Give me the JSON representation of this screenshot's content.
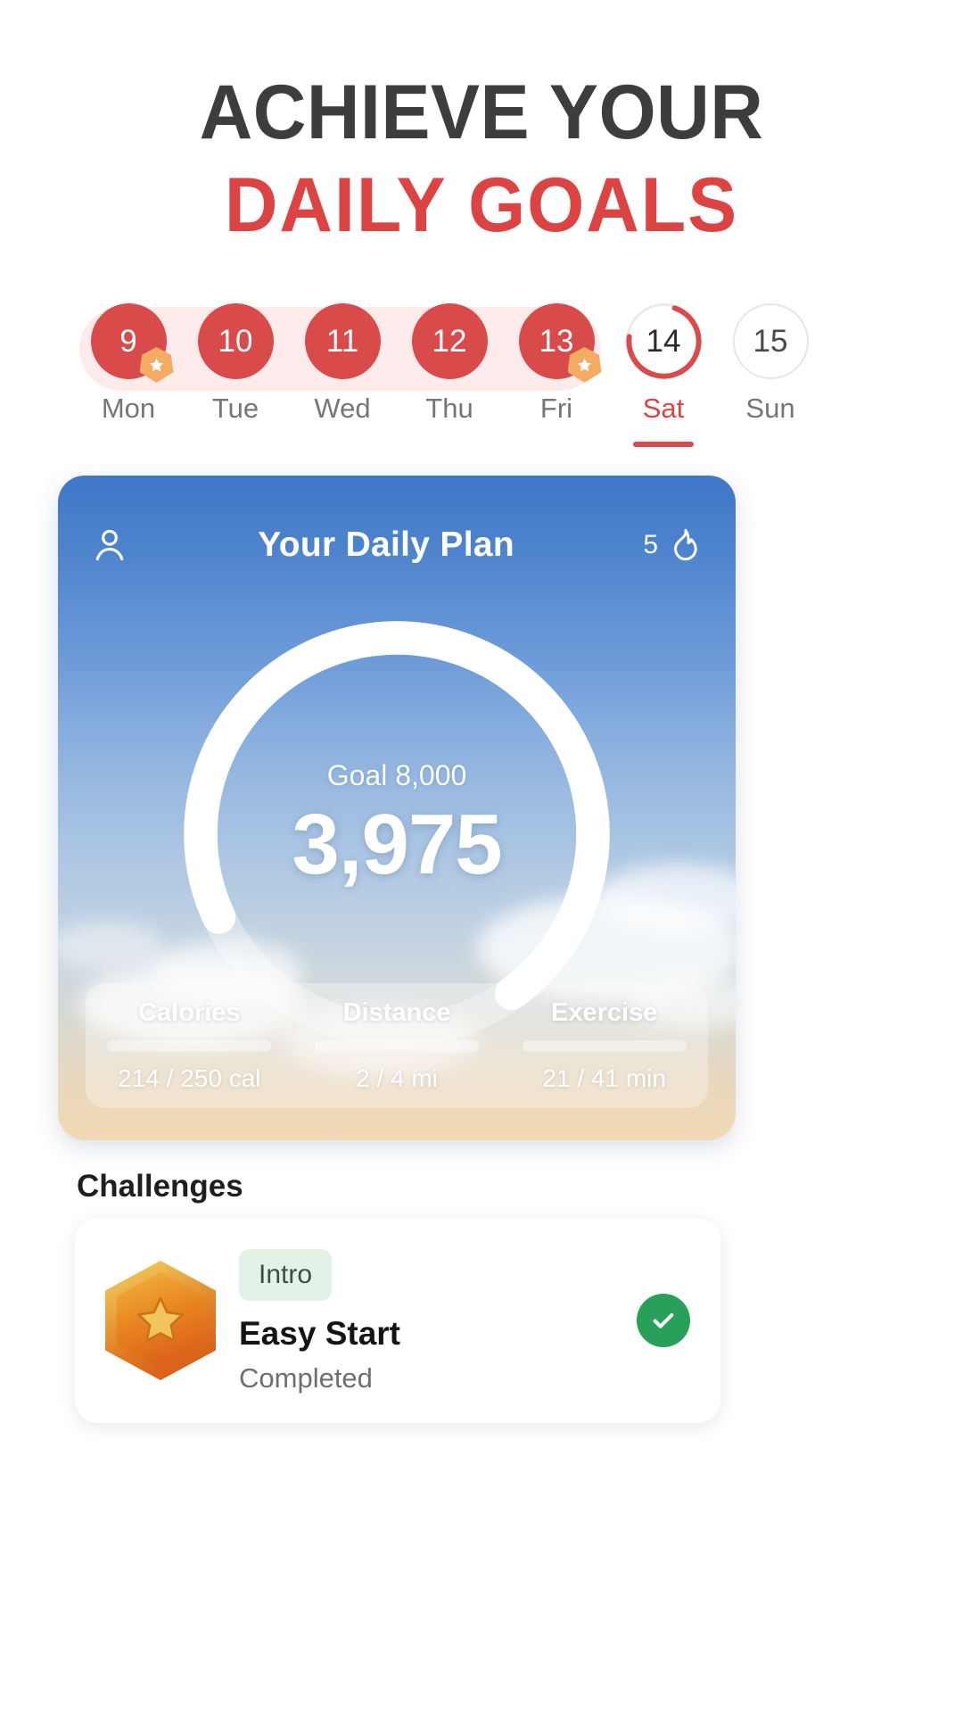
{
  "headline": {
    "line1": "ACHIEVE YOUR",
    "line2": "DAILY GOALS",
    "color_dark": "#3d3d3d",
    "color_red": "#dc4444"
  },
  "week": {
    "days": [
      {
        "date": "9",
        "label": "Mon",
        "state": "completed",
        "badge": "star"
      },
      {
        "date": "10",
        "label": "Tue",
        "state": "completed",
        "badge": ""
      },
      {
        "date": "11",
        "label": "Wed",
        "state": "completed",
        "badge": ""
      },
      {
        "date": "12",
        "label": "Thu",
        "state": "completed",
        "badge": ""
      },
      {
        "date": "13",
        "label": "Fri",
        "state": "completed",
        "badge": "star"
      },
      {
        "date": "14",
        "label": "Sat",
        "state": "today",
        "badge": ""
      },
      {
        "date": "15",
        "label": "Sun",
        "state": "upcoming",
        "badge": ""
      }
    ],
    "today_ring_percent": 72,
    "accent": "#d94a4a",
    "pill_background": "#fdeaea"
  },
  "plan_card": {
    "title": "Your Daily Plan",
    "profile_icon": "person-icon",
    "streak_count": "5",
    "streak_icon": "flame-icon",
    "goal_label": "Goal 8,000",
    "steps": "3,975",
    "goal_value": 8000,
    "steps_value": 3975,
    "ring_percent": 72,
    "stats": [
      {
        "label": "Calories",
        "value": "214 / 250 cal",
        "percent": 86
      },
      {
        "label": "Distance",
        "value": "2 / 4 mi",
        "percent": 50
      },
      {
        "label": "Exercise",
        "value": "21 / 41 min",
        "percent": 51
      }
    ]
  },
  "challenges": {
    "title": "Challenges",
    "items": [
      {
        "chip": "Intro",
        "name": "Easy Start",
        "status": "Completed",
        "medal_icon": "star-medal-icon",
        "completed_icon": "check-icon",
        "completed_color": "#28a05a"
      }
    ]
  }
}
